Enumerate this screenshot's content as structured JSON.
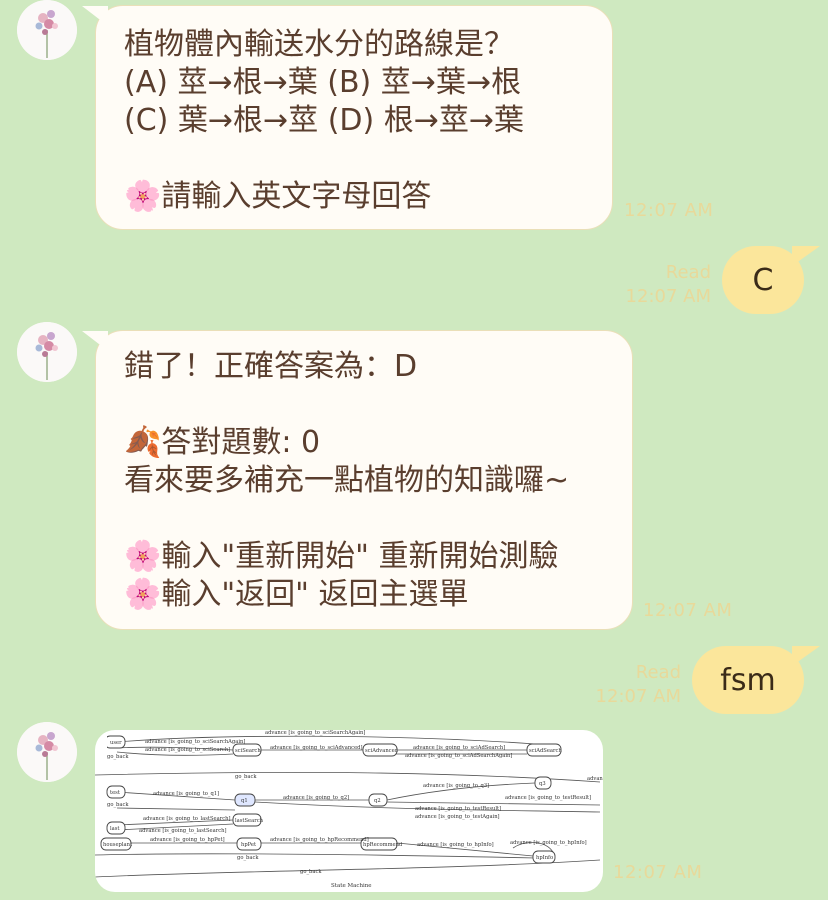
{
  "messages": [
    {
      "type": "incoming",
      "text": "植物體內輸送水分的路線是？\n(A) 莖→根→葉 (B) 莖→葉→根\n(C) 葉→根→莖 (D) 根→莖→葉\n\n🌸請輸入英文字母回答",
      "time": "12:07 AM"
    },
    {
      "type": "outgoing",
      "text": "C",
      "read": "Read",
      "time": "12:07 AM"
    },
    {
      "type": "incoming",
      "text": "錯了！正確答案為：D\n\n🍂答對題數: 0\n看來要多補充一點植物的知識囉~\n\n🌸輸入\"重新開始\" 重新開始測驗\n🌸輸入\"返回\" 返回主選單",
      "time": "12:07 AM"
    },
    {
      "type": "outgoing",
      "text": "fsm",
      "read": "Read",
      "time": "12:07 AM"
    },
    {
      "type": "incoming-image",
      "time": "12:07 AM",
      "image": {
        "title": "State Machine",
        "nodes": [
          "user",
          "sciSearch",
          "sciAdvanced",
          "sciAdSearch",
          "test",
          "q1",
          "q2",
          "q3",
          "lastSearch",
          "last",
          "houseplant",
          "hpPet",
          "hpRecommend",
          "hpInfo"
        ],
        "edges": [
          "advance [is_going_to_sciSearchAgain]",
          "advance [is_going_to_sciSearch]",
          "go_back",
          "advance [is_going_to_sciAdvanced]",
          "advance [is_going_to_sciAdSearch]",
          "advance [is_going_to_sciAdSearchAgain]",
          "advance [is_going_to_q1]",
          "advance [is_going_to_q2]",
          "advance [is_going_to_q3]",
          "advance [is_going_to_testResult]",
          "advance [is_going_to_testAgain]",
          "advance [is_going_to_lastSearch]",
          "advance [is_going_to_hpPet]",
          "advance [is_going_to_hpRecommend]",
          "advance [is_going_to_hpInfo]"
        ]
      }
    }
  ],
  "colors": {
    "background": "#cfe9c0",
    "incoming_bubble": "#fffcf6",
    "outgoing_bubble": "#fbe69b",
    "text": "#5a3e2e",
    "meta": "#e8d99a"
  },
  "icons": {
    "avatar": "flower-bouquet-avatar"
  }
}
